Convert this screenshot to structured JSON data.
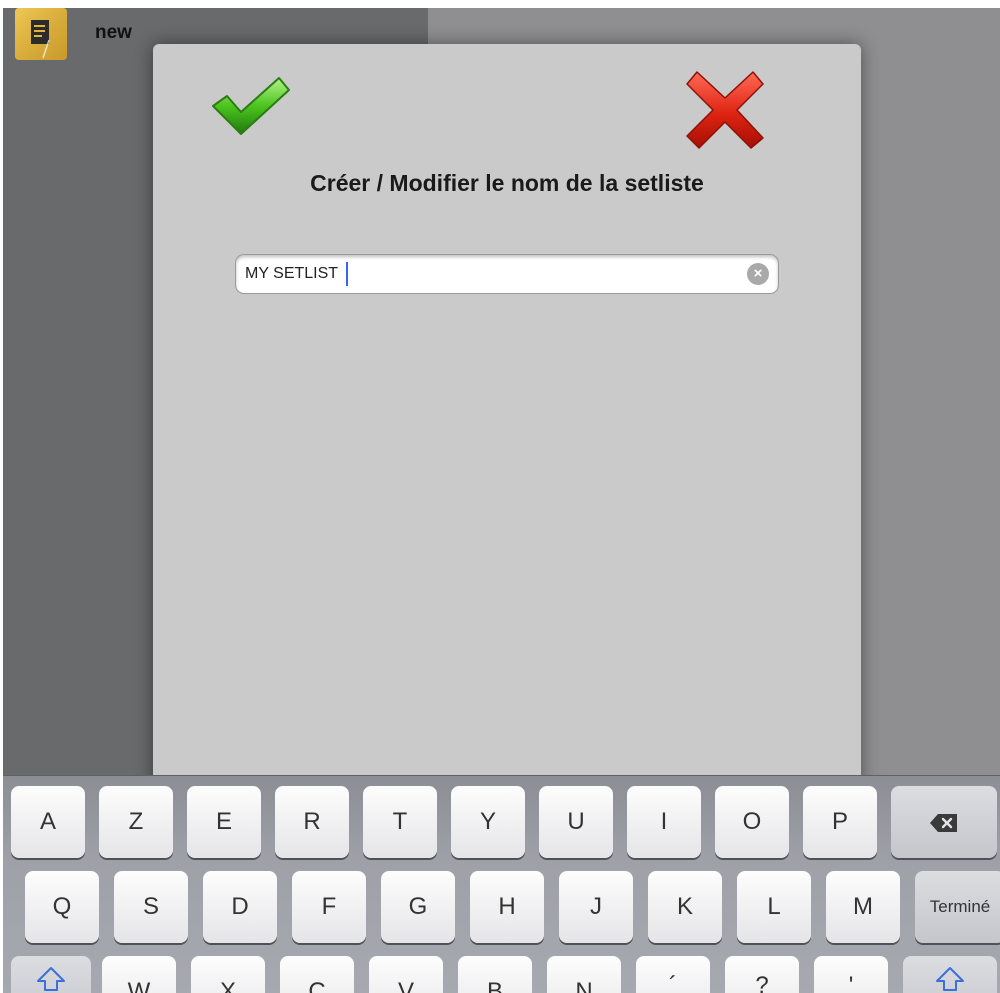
{
  "list": {
    "items": [
      {
        "title": "new",
        "icon": "note-icon"
      }
    ]
  },
  "dialog": {
    "title": "Créer / Modifier le nom de la setliste",
    "confirm_icon": "checkmark-icon",
    "cancel_icon": "close-icon",
    "name_field": {
      "value": "MY SETLIST",
      "clear_icon": "clear-icon"
    }
  },
  "keyboard": {
    "row1": [
      "A",
      "Z",
      "E",
      "R",
      "T",
      "Y",
      "U",
      "I",
      "O",
      "P"
    ],
    "row2": [
      "Q",
      "S",
      "D",
      "F",
      "G",
      "H",
      "J",
      "K",
      "L",
      "M"
    ],
    "row3": [
      "W",
      "X",
      "C",
      "V",
      "B",
      "N",
      "´",
      "?",
      "'"
    ],
    "backspace_icon": "backspace-icon",
    "shift_icon": "shift-icon",
    "done_label": "Terminé"
  },
  "colors": {
    "dialog_bg": "#cacaca",
    "confirm_green": "#3fb41a",
    "cancel_red": "#d91f12",
    "caret_blue": "#3366ff"
  }
}
